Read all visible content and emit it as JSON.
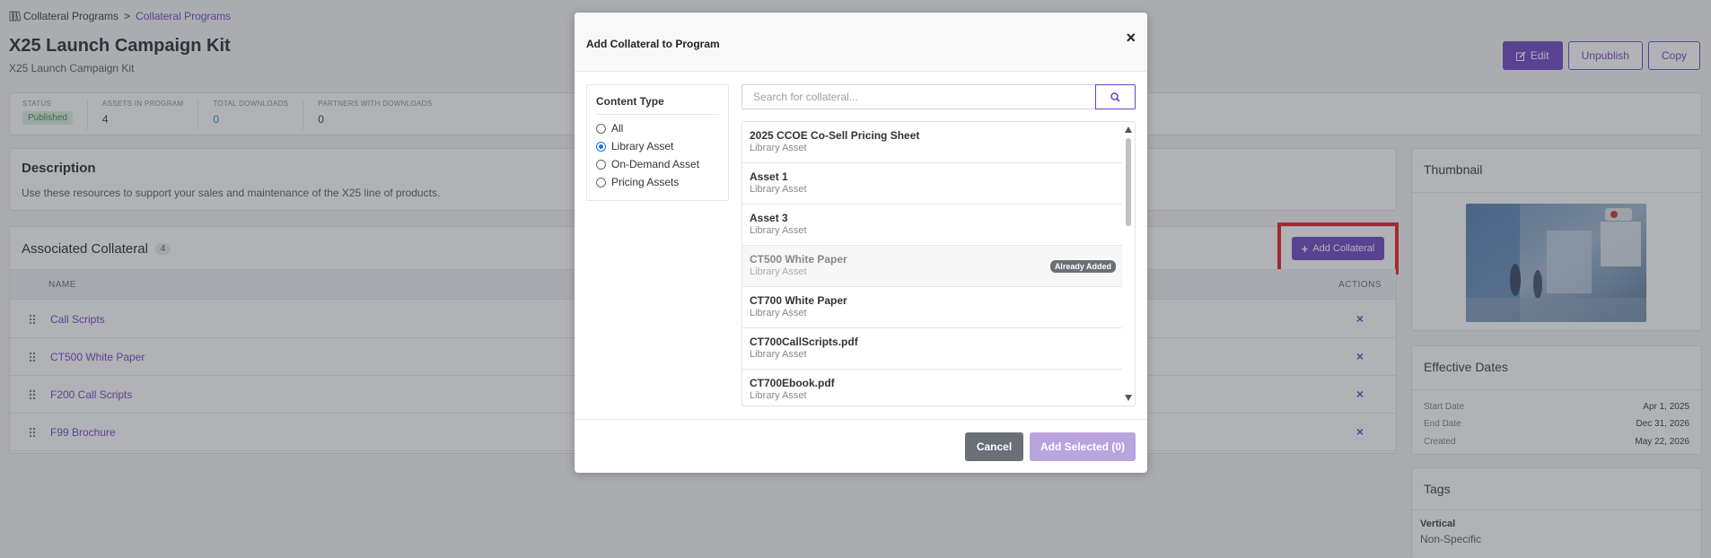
{
  "breadcrumb": {
    "root": "Collateral Programs",
    "separator": ">",
    "current": "Collateral Programs"
  },
  "program": {
    "title": "X25 Launch Campaign Kit",
    "subtitle": "X25 Launch Campaign Kit"
  },
  "top_actions": {
    "edit": "Edit",
    "unpublish": "Unpublish",
    "copy": "Copy"
  },
  "stats": [
    {
      "label": "STATUS",
      "value": "Published"
    },
    {
      "label": "ASSETS IN PROGRAM",
      "value": "4"
    },
    {
      "label": "TOTAL DOWNLOADS",
      "value": "0"
    },
    {
      "label": "PARTNERS WITH DOWNLOADS",
      "value": "0"
    }
  ],
  "description": {
    "heading": "Description",
    "text": "Use these resources to support your sales and maintenance of the X25 line of products."
  },
  "associated": {
    "heading": "Associated Collateral",
    "count": "4",
    "add_button": "Add Collateral",
    "col_name": "NAME",
    "col_actions": "ACTIONS",
    "rows": [
      {
        "name": "Call Scripts",
        "action": "×"
      },
      {
        "name": "CT500 White Paper",
        "action": "×"
      },
      {
        "name": "F200 Call Scripts",
        "action": "×"
      },
      {
        "name": "F99 Brochure",
        "action": "×"
      }
    ]
  },
  "thumbnail": {
    "heading": "Thumbnail"
  },
  "dates": {
    "heading": "Effective Dates",
    "rows": [
      {
        "label": "Start Date",
        "value": "Apr 1, 2025"
      },
      {
        "label": "End Date",
        "value": "Dec 31, 2026"
      },
      {
        "label": "Created",
        "value": "May 22, 2026"
      }
    ]
  },
  "tags": {
    "heading": "Tags",
    "label": "Vertical",
    "value": "Non-Specific"
  },
  "modal": {
    "title": "Add Collateral to Program",
    "close": "×",
    "content_type": {
      "heading": "Content Type",
      "options": [
        "All",
        "Library Asset",
        "On-Demand Asset",
        "Pricing Assets"
      ],
      "selected": "Library Asset"
    },
    "search": {
      "placeholder": "Search for collateral..."
    },
    "items": [
      {
        "name": "2025 CCOE Co-Sell Pricing Sheet",
        "type": "Library Asset",
        "badge": ""
      },
      {
        "name": "Asset 1",
        "type": "Library Asset",
        "badge": ""
      },
      {
        "name": "Asset 3",
        "type": "Library Asset",
        "badge": ""
      },
      {
        "name": "CT500 White Paper",
        "type": "Library Asset",
        "badge": "Already Added"
      },
      {
        "name": "CT700 White Paper",
        "type": "Library Asset",
        "badge": ""
      },
      {
        "name": "CT700CallScripts.pdf",
        "type": "Library Asset",
        "badge": ""
      },
      {
        "name": "CT700Ebook.pdf",
        "type": "Library Asset",
        "badge": ""
      }
    ],
    "cancel": "Cancel",
    "add_selected": "Add Selected (0)"
  },
  "colors": {
    "accent": "#6a3fc5",
    "highlight": "#e4151e",
    "overlay": "#46484e"
  }
}
